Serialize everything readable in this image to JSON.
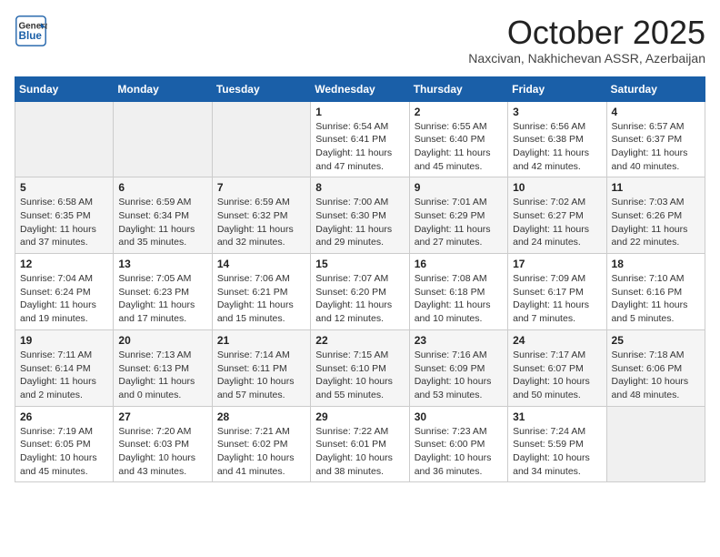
{
  "header": {
    "logo_line1": "General",
    "logo_line2": "Blue",
    "month": "October 2025",
    "location": "Naxcivan, Nakhichevan ASSR, Azerbaijan"
  },
  "weekdays": [
    "Sunday",
    "Monday",
    "Tuesday",
    "Wednesday",
    "Thursday",
    "Friday",
    "Saturday"
  ],
  "weeks": [
    [
      {
        "day": "",
        "content": ""
      },
      {
        "day": "",
        "content": ""
      },
      {
        "day": "",
        "content": ""
      },
      {
        "day": "1",
        "content": "Sunrise: 6:54 AM\nSunset: 6:41 PM\nDaylight: 11 hours\nand 47 minutes."
      },
      {
        "day": "2",
        "content": "Sunrise: 6:55 AM\nSunset: 6:40 PM\nDaylight: 11 hours\nand 45 minutes."
      },
      {
        "day": "3",
        "content": "Sunrise: 6:56 AM\nSunset: 6:38 PM\nDaylight: 11 hours\nand 42 minutes."
      },
      {
        "day": "4",
        "content": "Sunrise: 6:57 AM\nSunset: 6:37 PM\nDaylight: 11 hours\nand 40 minutes."
      }
    ],
    [
      {
        "day": "5",
        "content": "Sunrise: 6:58 AM\nSunset: 6:35 PM\nDaylight: 11 hours\nand 37 minutes."
      },
      {
        "day": "6",
        "content": "Sunrise: 6:59 AM\nSunset: 6:34 PM\nDaylight: 11 hours\nand 35 minutes."
      },
      {
        "day": "7",
        "content": "Sunrise: 6:59 AM\nSunset: 6:32 PM\nDaylight: 11 hours\nand 32 minutes."
      },
      {
        "day": "8",
        "content": "Sunrise: 7:00 AM\nSunset: 6:30 PM\nDaylight: 11 hours\nand 29 minutes."
      },
      {
        "day": "9",
        "content": "Sunrise: 7:01 AM\nSunset: 6:29 PM\nDaylight: 11 hours\nand 27 minutes."
      },
      {
        "day": "10",
        "content": "Sunrise: 7:02 AM\nSunset: 6:27 PM\nDaylight: 11 hours\nand 24 minutes."
      },
      {
        "day": "11",
        "content": "Sunrise: 7:03 AM\nSunset: 6:26 PM\nDaylight: 11 hours\nand 22 minutes."
      }
    ],
    [
      {
        "day": "12",
        "content": "Sunrise: 7:04 AM\nSunset: 6:24 PM\nDaylight: 11 hours\nand 19 minutes."
      },
      {
        "day": "13",
        "content": "Sunrise: 7:05 AM\nSunset: 6:23 PM\nDaylight: 11 hours\nand 17 minutes."
      },
      {
        "day": "14",
        "content": "Sunrise: 7:06 AM\nSunset: 6:21 PM\nDaylight: 11 hours\nand 15 minutes."
      },
      {
        "day": "15",
        "content": "Sunrise: 7:07 AM\nSunset: 6:20 PM\nDaylight: 11 hours\nand 12 minutes."
      },
      {
        "day": "16",
        "content": "Sunrise: 7:08 AM\nSunset: 6:18 PM\nDaylight: 11 hours\nand 10 minutes."
      },
      {
        "day": "17",
        "content": "Sunrise: 7:09 AM\nSunset: 6:17 PM\nDaylight: 11 hours\nand 7 minutes."
      },
      {
        "day": "18",
        "content": "Sunrise: 7:10 AM\nSunset: 6:16 PM\nDaylight: 11 hours\nand 5 minutes."
      }
    ],
    [
      {
        "day": "19",
        "content": "Sunrise: 7:11 AM\nSunset: 6:14 PM\nDaylight: 11 hours\nand 2 minutes."
      },
      {
        "day": "20",
        "content": "Sunrise: 7:13 AM\nSunset: 6:13 PM\nDaylight: 11 hours\nand 0 minutes."
      },
      {
        "day": "21",
        "content": "Sunrise: 7:14 AM\nSunset: 6:11 PM\nDaylight: 10 hours\nand 57 minutes."
      },
      {
        "day": "22",
        "content": "Sunrise: 7:15 AM\nSunset: 6:10 PM\nDaylight: 10 hours\nand 55 minutes."
      },
      {
        "day": "23",
        "content": "Sunrise: 7:16 AM\nSunset: 6:09 PM\nDaylight: 10 hours\nand 53 minutes."
      },
      {
        "day": "24",
        "content": "Sunrise: 7:17 AM\nSunset: 6:07 PM\nDaylight: 10 hours\nand 50 minutes."
      },
      {
        "day": "25",
        "content": "Sunrise: 7:18 AM\nSunset: 6:06 PM\nDaylight: 10 hours\nand 48 minutes."
      }
    ],
    [
      {
        "day": "26",
        "content": "Sunrise: 7:19 AM\nSunset: 6:05 PM\nDaylight: 10 hours\nand 45 minutes."
      },
      {
        "day": "27",
        "content": "Sunrise: 7:20 AM\nSunset: 6:03 PM\nDaylight: 10 hours\nand 43 minutes."
      },
      {
        "day": "28",
        "content": "Sunrise: 7:21 AM\nSunset: 6:02 PM\nDaylight: 10 hours\nand 41 minutes."
      },
      {
        "day": "29",
        "content": "Sunrise: 7:22 AM\nSunset: 6:01 PM\nDaylight: 10 hours\nand 38 minutes."
      },
      {
        "day": "30",
        "content": "Sunrise: 7:23 AM\nSunset: 6:00 PM\nDaylight: 10 hours\nand 36 minutes."
      },
      {
        "day": "31",
        "content": "Sunrise: 7:24 AM\nSunset: 5:59 PM\nDaylight: 10 hours\nand 34 minutes."
      },
      {
        "day": "",
        "content": ""
      }
    ]
  ]
}
